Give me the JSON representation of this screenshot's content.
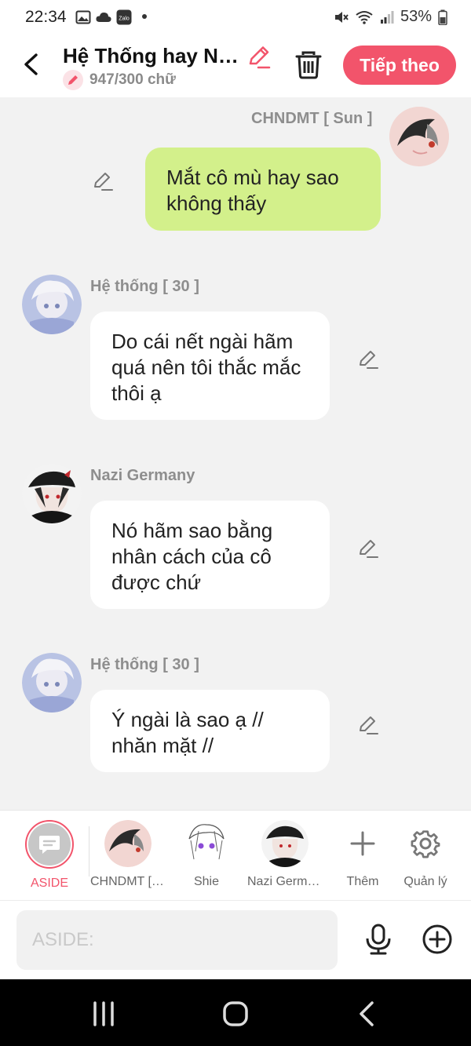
{
  "status": {
    "time": "22:34",
    "battery": "53%"
  },
  "header": {
    "title": "Hệ Thống hay Nazi Germany",
    "word_count": "947/300 chữ",
    "next_button": "Tiếp theo"
  },
  "messages": [
    {
      "speaker": "CHNDMT [ Sun ]",
      "text": "Mắt cô mù hay sao không thấy",
      "side": "right"
    },
    {
      "speaker": "Hệ thống [ 30 ]",
      "text": "Do cái nết ngài hãm quá nên tôi thắc mắc thôi ạ",
      "side": "left"
    },
    {
      "speaker": "Nazi Germany",
      "text": "Nó hãm sao bằng nhân cách của cô được chứ",
      "side": "left"
    },
    {
      "speaker": "Hệ thống [ 30 ]",
      "text": "Ý ngài là sao ạ // nhăn mặt //",
      "side": "left"
    }
  ],
  "characters": {
    "aside": "ASIDE",
    "items": [
      {
        "label": "CHNDMT [ Sun ]"
      },
      {
        "label": "Shie"
      },
      {
        "label": "Nazi Germany"
      }
    ],
    "add": "Thêm",
    "manage": "Quản lý"
  },
  "input": {
    "placeholder": "ASIDE:"
  },
  "colors": {
    "accent": "#f2546b",
    "my_bubble": "#d3f08b",
    "background": "#f2f2f2"
  }
}
